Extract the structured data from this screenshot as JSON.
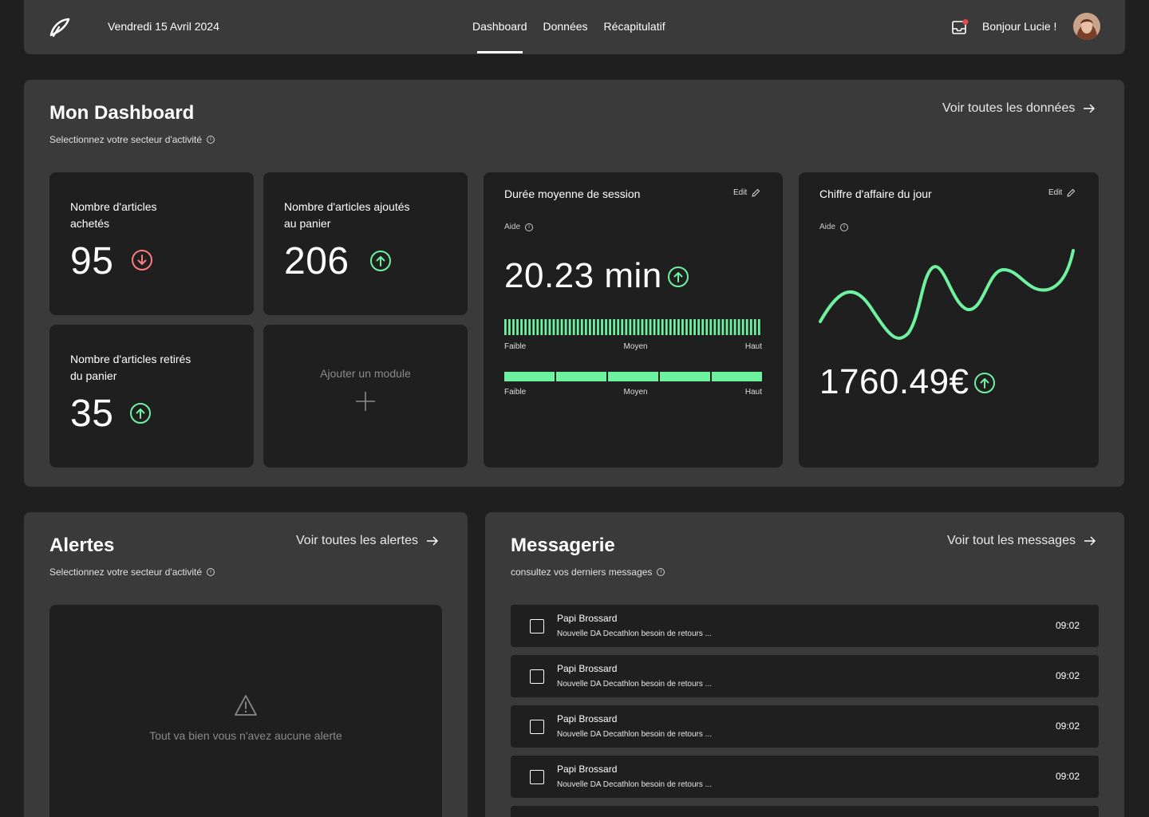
{
  "header": {
    "date": "Vendredi 15 Avril 2024",
    "nav": [
      "Dashboard",
      "Données",
      "Récapitulatif"
    ],
    "active_nav": "Dashboard",
    "greeting": "Bonjour Lucie !",
    "notification_dot_color": "#e5484d"
  },
  "dashboard": {
    "title": "Mon Dashboard",
    "subtitle": "Selectionnez votre secteur d'activité",
    "link": "Voir toutes les données",
    "cards": [
      {
        "label": "Nombre d'articles achetés",
        "value": "95",
        "trend": "down",
        "trend_color": "#ff7a7a"
      },
      {
        "label": "Nombre d'articles ajoutés au panier",
        "value": "206",
        "trend": "up",
        "trend_color": "#6ef2a0"
      },
      {
        "label": "Nombre d'articles retirés du panier",
        "value": "35",
        "trend": "up",
        "trend_color": "#6ef2a0"
      }
    ],
    "add_module": "Ajouter un module",
    "session": {
      "title": "Durée moyenne de session",
      "edit": "Edit",
      "help": "Aide",
      "value": "20.23 min",
      "trend": "up",
      "scale": [
        "Faible",
        "Moyen",
        "Haut"
      ],
      "bar_level": 1.0,
      "segments": 5
    },
    "revenue": {
      "title": "Chiffre d'affaire du jour",
      "edit": "Edit",
      "help": "Aide",
      "value": "1760.49€",
      "trend": "up"
    },
    "accent": "#6ef2a0"
  },
  "alerts": {
    "title": "Alertes",
    "subtitle": "Selectionnez votre secteur d'activité",
    "link": "Voir toutes les alertes",
    "empty_message": "Tout va bien vous n'avez aucune alerte"
  },
  "messages": {
    "title": "Messagerie",
    "subtitle": "consultez vos derniers messages",
    "link": "Voir tout les messages",
    "items": [
      {
        "sender": "Papi Brossard",
        "preview": "Nouvelle DA Decathlon besoin de retours ...",
        "time": "09:02"
      },
      {
        "sender": "Papi Brossard",
        "preview": "Nouvelle DA Decathlon besoin de retours ...",
        "time": "09:02"
      },
      {
        "sender": "Papi Brossard",
        "preview": "Nouvelle DA Decathlon besoin de retours ...",
        "time": "09:02"
      },
      {
        "sender": "Papi Brossard",
        "preview": "Nouvelle DA Decathlon besoin de retours ...",
        "time": "09:02"
      }
    ]
  }
}
